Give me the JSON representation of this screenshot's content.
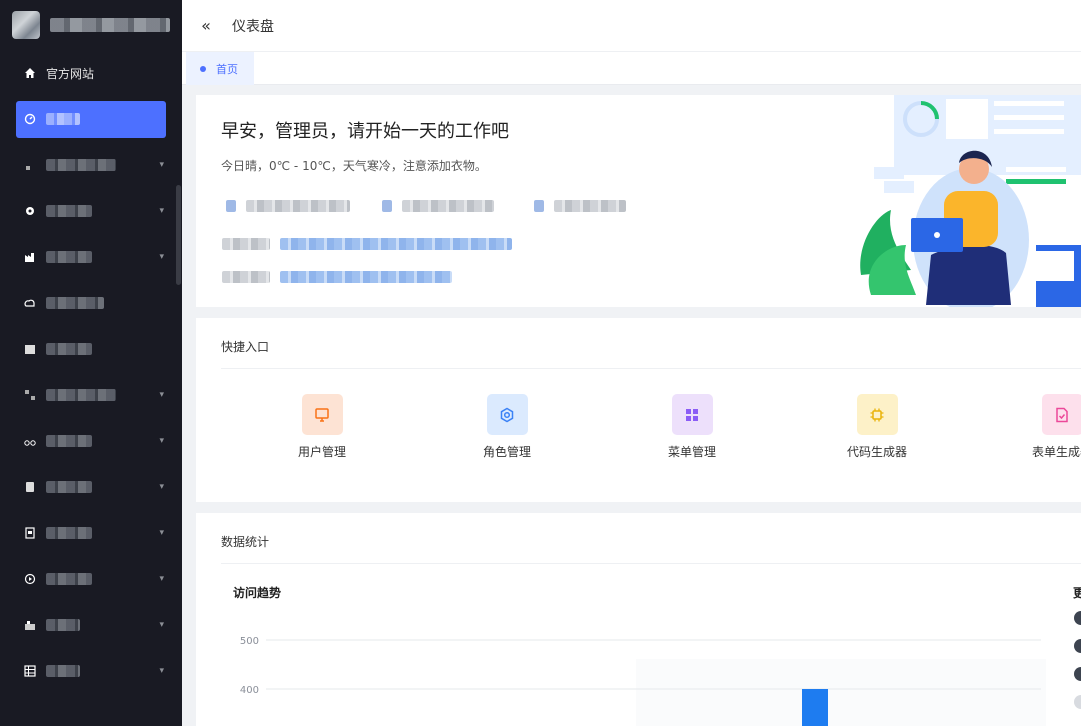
{
  "sidebar": {
    "items": [
      {
        "label": "官方网站",
        "icon": "home-icon"
      },
      {
        "label": "",
        "icon": "dashboard-icon",
        "active": true
      },
      {
        "label": "",
        "icon": "user-icon",
        "has_children": true
      },
      {
        "label": "",
        "icon": "gear-icon",
        "has_children": true
      },
      {
        "label": "",
        "icon": "factory-icon",
        "has_children": true
      },
      {
        "label": "",
        "icon": "cloud-icon"
      },
      {
        "label": "",
        "icon": "box-icon"
      },
      {
        "label": "",
        "icon": "grid-icon",
        "has_children": true
      },
      {
        "label": "",
        "icon": "bike-icon",
        "has_children": true
      },
      {
        "label": "",
        "icon": "document-icon",
        "has_children": true
      },
      {
        "label": "",
        "icon": "file-icon",
        "has_children": true
      },
      {
        "label": "",
        "icon": "record-icon",
        "has_children": true
      },
      {
        "label": "",
        "icon": "shop-icon",
        "has_children": true
      },
      {
        "label": "",
        "icon": "table-icon",
        "has_children": true
      }
    ]
  },
  "topbar": {
    "title": "仪表盘",
    "collapse_icon": "double-chevron-left-icon"
  },
  "tabs": [
    {
      "label": "首页",
      "active": true
    }
  ],
  "greeting": {
    "title": "早安，管理员，请开始一天的工作吧",
    "subtitle": "今日晴，0℃ - 10℃，天气寒冷，注意添加衣物。"
  },
  "quick_entry": {
    "title": "快捷入口",
    "items": [
      {
        "label": "用户管理",
        "icon": "monitor-icon",
        "color": "#f97316",
        "bg": "#fde3d4"
      },
      {
        "label": "角色管理",
        "icon": "settings-icon",
        "color": "#3b82f6",
        "bg": "#dbeafe"
      },
      {
        "label": "菜单管理",
        "icon": "grid-icon",
        "color": "#8b5cf6",
        "bg": "#ede0fb"
      },
      {
        "label": "代码生成器",
        "icon": "chip-icon",
        "color": "#eab308",
        "bg": "#fdf1c8"
      },
      {
        "label": "表单生成器",
        "icon": "form-icon",
        "color": "#ec4899",
        "bg": "#fde0ec"
      }
    ]
  },
  "stats": {
    "title": "数据统计",
    "chart_title": "访问趋势",
    "side_title_partial": "更"
  },
  "colors": {
    "accent": "#4d70ff",
    "sidebar_bg": "#191a23"
  },
  "chart_data": {
    "type": "bar",
    "title": "访问趋势",
    "y_ticks": [
      500,
      400
    ],
    "ylim": [
      0,
      500
    ],
    "series": [
      {
        "values": [
          400
        ]
      }
    ],
    "grid": true
  }
}
